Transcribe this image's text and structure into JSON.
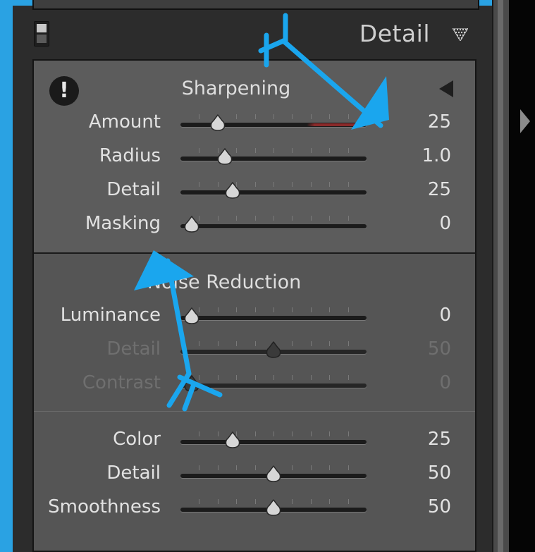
{
  "panel": {
    "title": "Detail",
    "collapse_icon": "down-triangle-icon",
    "toggle_icon": "panel-toggle-icon"
  },
  "colors": {
    "annotation": "#1aa6ee",
    "panel_bg": "#555555",
    "text": "#e2e2e2",
    "text_disabled": "#6f6f6f"
  },
  "sharpening": {
    "title": "Sharpening",
    "warning_icon": "exclamation-icon",
    "warning_glyph": "!",
    "disclosure_icon": "left-triangle-icon",
    "sliders": [
      {
        "label": "Amount",
        "value": "25",
        "level": 0.2
      },
      {
        "label": "Radius",
        "value": "1.0",
        "level": 0.24
      },
      {
        "label": "Detail",
        "value": "25",
        "level": 0.28
      },
      {
        "label": "Masking",
        "value": "0",
        "level": 0.06
      }
    ]
  },
  "noise_reduction": {
    "title": "Noise Reduction",
    "luminance": [
      {
        "label": "Luminance",
        "value": "0",
        "level": 0.06,
        "enabled": true
      },
      {
        "label": "Detail",
        "value": "50",
        "level": 0.5,
        "enabled": false
      },
      {
        "label": "Contrast",
        "value": "0",
        "level": 0.06,
        "enabled": false
      }
    ],
    "color": [
      {
        "label": "Color",
        "value": "25",
        "level": 0.28,
        "enabled": true
      },
      {
        "label": "Detail",
        "value": "50",
        "level": 0.5,
        "enabled": true
      },
      {
        "label": "Smoothness",
        "value": "50",
        "level": 0.5,
        "enabled": true
      }
    ]
  }
}
